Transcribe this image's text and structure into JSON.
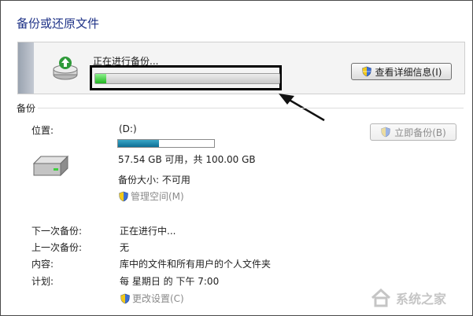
{
  "page_title": "备份或还原文件",
  "status": {
    "text": "正在进行备份...",
    "progress": 0.06,
    "details_button": "查看详细信息(I)"
  },
  "section": {
    "label": "备份"
  },
  "location": {
    "label": "位置:",
    "drive": "(D:)",
    "used_fraction": 0.4246,
    "space": "57.54 GB 可用，共 100.00 GB",
    "backup_size": "备份大小: 不可用",
    "manage_link": "管理空间(M)",
    "backup_now_button": "立即备份(B)"
  },
  "details": [
    {
      "label": "下一次备份:",
      "value": "正在进行中..."
    },
    {
      "label": "上一次备份:",
      "value": "无"
    },
    {
      "label": "内容:",
      "value": "库中的文件和所有用户的个人文件夹"
    },
    {
      "label": "计划:",
      "value": "每 星期日 的 下午 7:00"
    }
  ],
  "change_settings_link": "更改设置(C)",
  "watermark": "系统之家",
  "colors": {
    "title": "#1e3287",
    "progress_green": "#20b520",
    "disk_blue": "#0d6f95",
    "link_disabled": "#8a8a8a"
  }
}
